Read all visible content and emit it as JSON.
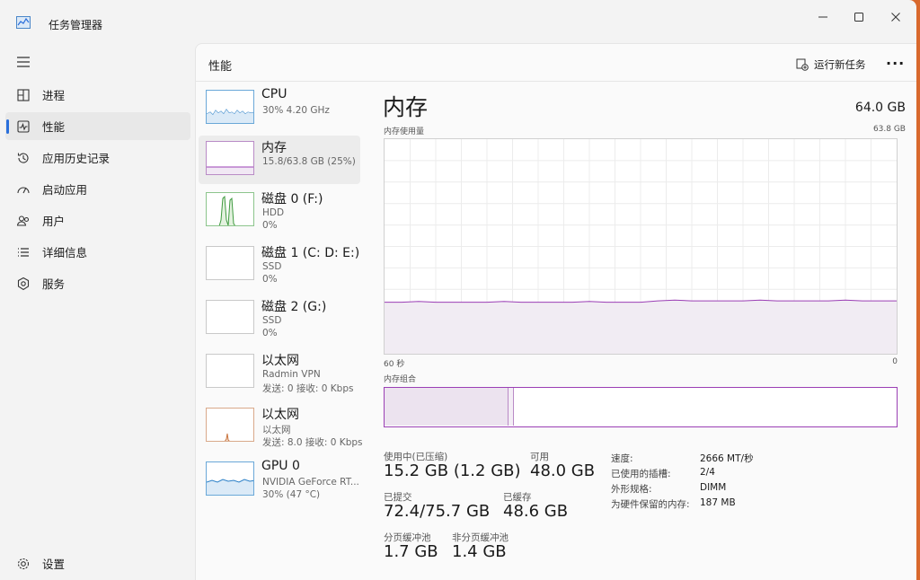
{
  "window": {
    "title": "任务管理器",
    "accent": "#2a6fdb",
    "memory_color": "#9b3fb5"
  },
  "sidebar": {
    "items": [
      {
        "label": "进程",
        "icon": "processes-icon"
      },
      {
        "label": "性能",
        "icon": "performance-icon",
        "active": true
      },
      {
        "label": "应用历史记录",
        "icon": "app-history-icon"
      },
      {
        "label": "启动应用",
        "icon": "startup-icon"
      },
      {
        "label": "用户",
        "icon": "users-icon"
      },
      {
        "label": "详细信息",
        "icon": "details-icon"
      },
      {
        "label": "服务",
        "icon": "services-icon"
      }
    ],
    "settings_label": "设置"
  },
  "header": {
    "title": "性能",
    "run_task_label": "运行新任务",
    "more_label": "···"
  },
  "devices": [
    {
      "name": "CPU",
      "sub1": "30%  4.20 GHz",
      "sub2": ""
    },
    {
      "name": "内存",
      "sub1": "15.8/63.8 GB (25%)",
      "sub2": "",
      "active": true
    },
    {
      "name": "磁盘 0 (F:)",
      "sub1": "HDD",
      "sub2": "0%"
    },
    {
      "name": "磁盘 1 (C: D: E:)",
      "sub1": "SSD",
      "sub2": "0%"
    },
    {
      "name": "磁盘 2 (G:)",
      "sub1": "SSD",
      "sub2": "0%"
    },
    {
      "name": "以太网",
      "sub1": "Radmin VPN",
      "sub2": "发送: 0  接收: 0 Kbps"
    },
    {
      "name": "以太网",
      "sub1": "以太网",
      "sub2": "发送: 8.0  接收: 0 Kbps"
    },
    {
      "name": "GPU 0",
      "sub1": "NVIDIA GeForce RT...",
      "sub2": "30% (47 °C)"
    }
  ],
  "memory": {
    "title": "内存",
    "total": "64.0 GB",
    "usage_label": "内存使用量",
    "usage_max": "63.8 GB",
    "time_left": "60 秒",
    "time_right": "0",
    "usage_fraction": 0.24,
    "composition_label": "内存组合",
    "composition_used_fraction": 0.24,
    "stats": {
      "in_use_label": "使用中(已压缩)",
      "in_use_value": "15.2 GB (1.2 GB)",
      "available_label": "可用",
      "available_value": "48.0 GB",
      "committed_label": "已提交",
      "committed_value": "72.4/75.7 GB",
      "cached_label": "已缓存",
      "cached_value": "48.6 GB",
      "paged_label": "分页缓冲池",
      "paged_value": "1.7 GB",
      "nonpaged_label": "非分页缓冲池",
      "nonpaged_value": "1.4 GB"
    },
    "properties": [
      {
        "key": "速度:",
        "value": "2666 MT/秒"
      },
      {
        "key": "已使用的插槽:",
        "value": "2/4"
      },
      {
        "key": "外形规格:",
        "value": "DIMM"
      },
      {
        "key": "为硬件保留的内存:",
        "value": "187 MB"
      }
    ]
  }
}
